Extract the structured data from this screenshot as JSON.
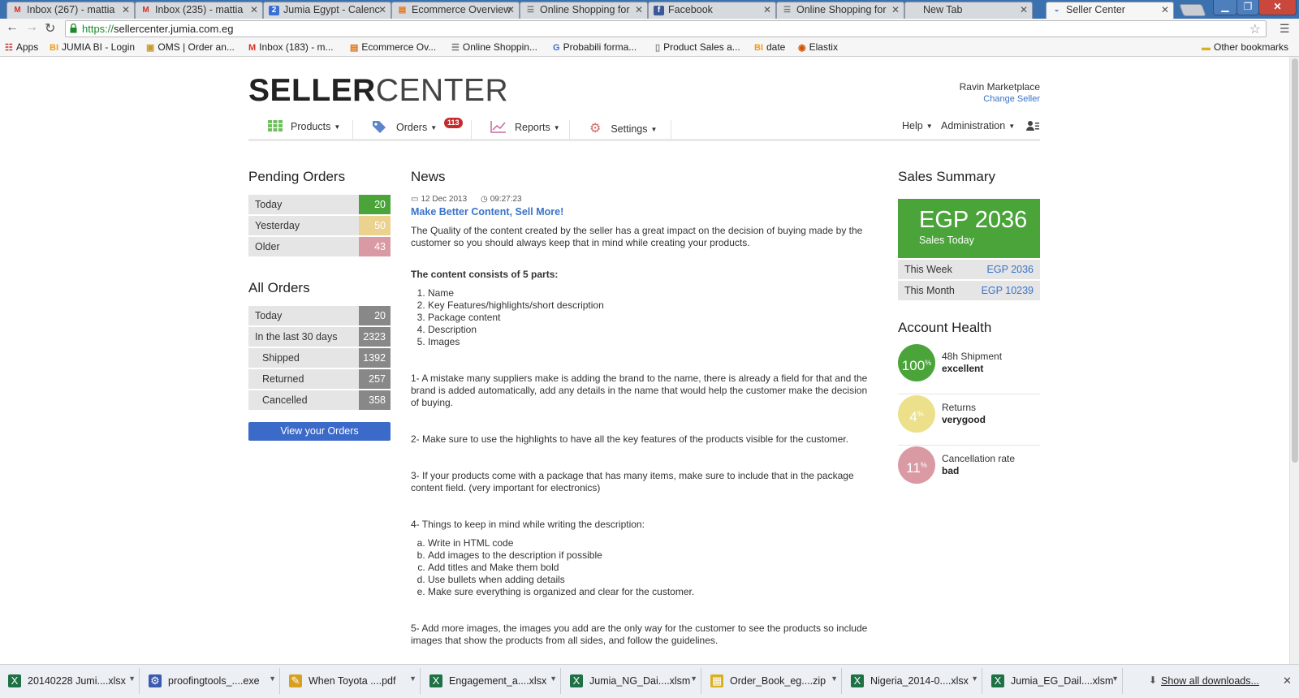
{
  "browser": {
    "tabs": [
      {
        "title": "Inbox (267) - mattia",
        "icon": "gmail-icon",
        "color": "#d93025",
        "glyph": "M"
      },
      {
        "title": "Inbox (235) - mattia",
        "icon": "gmail-icon",
        "color": "#d93025",
        "glyph": "M"
      },
      {
        "title": "Jumia Egypt - Calenc",
        "icon": "calendar-icon",
        "color": "#3b6fd6",
        "glyph": "2"
      },
      {
        "title": "Ecommerce Overview",
        "icon": "analytics-icon",
        "color": "#e8710a",
        "glyph": "▤"
      },
      {
        "title": "Online Shopping for",
        "icon": "cart-icon",
        "color": "#777777",
        "glyph": "☰"
      },
      {
        "title": "Facebook",
        "icon": "facebook-icon",
        "color": "#3b5998",
        "glyph": "f"
      },
      {
        "title": "Online Shopping for",
        "icon": "cart-icon",
        "color": "#777777",
        "glyph": "☰"
      },
      {
        "title": "New Tab",
        "icon": "",
        "color": "#d6d9de",
        "glyph": ""
      },
      {
        "title": "Seller Center",
        "icon": "seller-center-icon",
        "color": "#6b8fd0",
        "glyph": "◒"
      }
    ],
    "url_scheme": "https://",
    "url_rest": "sellercenter.jumia.com.eg",
    "bookmarks": [
      {
        "label": "Apps",
        "icon": "apps-icon",
        "glyph": "☷",
        "color": "#c0392b"
      },
      {
        "label": "JUMIA BI - Login",
        "icon": "bi-icon",
        "glyph": "BI",
        "color": "#f39c12"
      },
      {
        "label": "OMS | Order an...",
        "icon": "box-icon",
        "glyph": "▣",
        "color": "#c89b2a"
      },
      {
        "label": "Inbox (183) - m...",
        "icon": "gmail-icon",
        "glyph": "M",
        "color": "#d93025"
      },
      {
        "label": "Ecommerce Ov...",
        "icon": "analytics-icon",
        "glyph": "▤",
        "color": "#e8710a"
      },
      {
        "label": "Online Shoppin...",
        "icon": "cart-icon",
        "glyph": "☰",
        "color": "#777777"
      },
      {
        "label": "Probabili forma...",
        "icon": "google-icon",
        "glyph": "G",
        "color": "#3b6fd6"
      },
      {
        "label": "Product Sales a...",
        "icon": "page-icon",
        "glyph": "▯",
        "color": "#888888"
      },
      {
        "label": "date",
        "icon": "bi-icon",
        "glyph": "BI",
        "color": "#f39c12"
      },
      {
        "label": "Elastix",
        "icon": "elastix-icon",
        "glyph": "◉",
        "color": "#d35400"
      }
    ],
    "other_bookmarks": "Other bookmarks"
  },
  "header": {
    "logo_bold": "SELLER",
    "logo_light": "CENTER",
    "seller_name": "Ravin Marketplace",
    "change_seller": "Change Seller"
  },
  "nav": {
    "products": "Products",
    "orders": "Orders",
    "orders_badge": "113",
    "reports": "Reports",
    "settings": "Settings",
    "help": "Help",
    "administration": "Administration"
  },
  "pending_orders": {
    "title": "Pending Orders",
    "rows": [
      {
        "label": "Today",
        "value": "20",
        "color": "#4aa43a"
      },
      {
        "label": "Yesterday",
        "value": "50",
        "color": "#ecd28f"
      },
      {
        "label": "Older",
        "value": "43",
        "color": "#d99aa3"
      }
    ]
  },
  "all_orders": {
    "title": "All Orders",
    "rows": [
      {
        "label": "Today",
        "value": "20"
      },
      {
        "label": "In the last 30 days",
        "value": "2323"
      },
      {
        "label": "Shipped",
        "value": "1392"
      },
      {
        "label": "Returned",
        "value": "257"
      },
      {
        "label": "Cancelled",
        "value": "358"
      }
    ],
    "button": "View your Orders",
    "value_color": "#888888"
  },
  "news": {
    "title": "News",
    "date": "12 Dec 2013",
    "time": "09:27:23",
    "headline": "Make Better Content, Sell More!",
    "intro": "The Quality of the content created by the seller has a great impact on the decision of buying made by the customer so you should always keep that in mind while creating your products.",
    "parts_heading": "The content consists of 5 parts:",
    "parts": [
      "Name",
      "Key Features/highlights/short description",
      "Package content",
      "Description",
      "Images"
    ],
    "p1": "1- A mistake many suppliers make is adding the brand to the name, there is already a field for that and the brand is added automatically, add any details in the name that would help the customer make the decision of buying.",
    "p2": "2- Make sure to use the highlights to have all the key features of the products visible for the customer.",
    "p3": "3- If your products come with a package that has many items, make sure to include that in the package content field. (very important for electronics)",
    "p4": "4- Things to keep in mind while writing the description:",
    "desc_items": [
      "Write in HTML code",
      "Add images to the description if possible",
      "Add titles and Make them bold",
      "Use bullets when adding details",
      "Make sure everything is organized and clear for the customer."
    ],
    "p5": "5- Add more images, the images you add are the only way for the customer to see the products so include images that show the products from all sides, and follow the guidelines."
  },
  "sales_summary": {
    "title": "Sales Summary",
    "today_amount": "EGP 2036",
    "today_label": "Sales Today",
    "week_label": "This Week",
    "week_value": "EGP 2036",
    "month_label": "This Month",
    "month_value": "EGP 10239"
  },
  "account_health": {
    "title": "Account Health",
    "items": [
      {
        "value": "100",
        "label": "48h Shipment",
        "status": "excellent",
        "color": "#4aa43a"
      },
      {
        "value": "4",
        "label": "Returns",
        "status": "verygood",
        "color": "#ece08a"
      },
      {
        "value": "11",
        "label": "Cancellation rate",
        "status": "bad",
        "color": "#d99aa3"
      }
    ]
  },
  "downloads": {
    "items": [
      {
        "name": "20140228 Jumi....xlsx",
        "icon": "excel-icon",
        "color": "#1e7145",
        "glyph": "X"
      },
      {
        "name": "proofingtools_....exe",
        "icon": "installer-icon",
        "color": "#3b5bb0",
        "glyph": "⚙"
      },
      {
        "name": "When Toyota ....pdf",
        "icon": "pdf-icon",
        "color": "#d8a020",
        "glyph": "✎"
      },
      {
        "name": "Engagement_a....xlsx",
        "icon": "excel-icon",
        "color": "#1e7145",
        "glyph": "X"
      },
      {
        "name": "Jumia_NG_Dai....xlsm",
        "icon": "excel-icon",
        "color": "#1e7145",
        "glyph": "X"
      },
      {
        "name": "Order_Book_eg....zip",
        "icon": "zip-icon",
        "color": "#d8b020",
        "glyph": "▦"
      },
      {
        "name": "Nigeria_2014-0....xlsx",
        "icon": "excel-icon",
        "color": "#1e7145",
        "glyph": "X"
      },
      {
        "name": "Jumia_EG_Dail....xlsm",
        "icon": "excel-icon",
        "color": "#1e7145",
        "glyph": "X"
      }
    ],
    "show_all": "Show all downloads..."
  }
}
